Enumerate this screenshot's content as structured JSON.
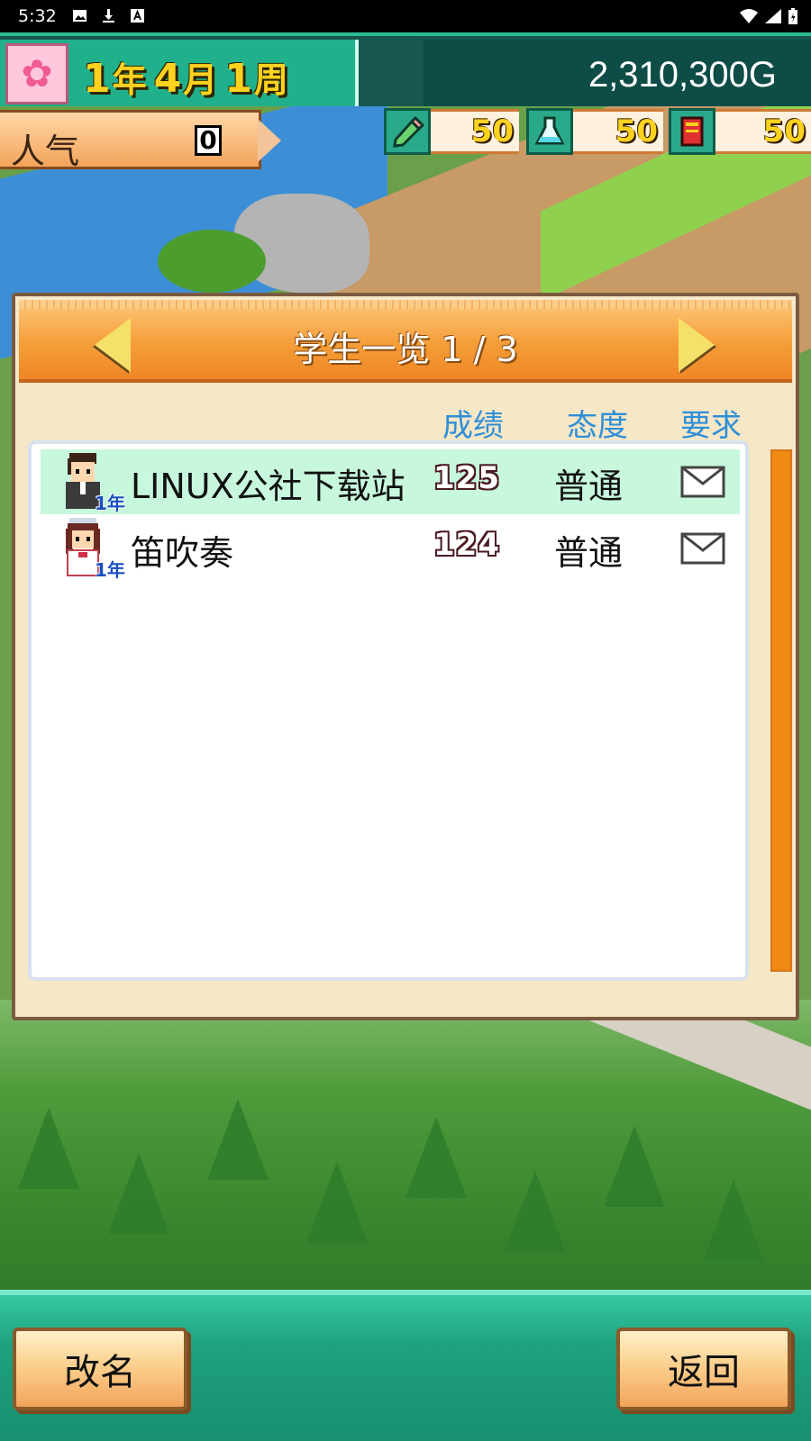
{
  "status_bar": {
    "time": "5:32"
  },
  "hud": {
    "date": {
      "year": "1",
      "year_unit": "年",
      "month": "4",
      "month_unit": "月",
      "week": "1",
      "week_unit": "周"
    },
    "money": "2,310,300G",
    "popularity": {
      "label": "人气",
      "value": "0"
    },
    "resources": [
      {
        "icon": "pencil-icon",
        "value": "50"
      },
      {
        "icon": "flask-icon",
        "value": "50"
      },
      {
        "icon": "book-icon",
        "value": "50"
      }
    ]
  },
  "dialog": {
    "title": "学生一览 1 / 3",
    "columns": {
      "score": "成绩",
      "attitude": "态度",
      "request": "要求"
    },
    "students": [
      {
        "name": "LINUX公社下载站",
        "grade": "1年",
        "score": "125",
        "attitude": "普通",
        "request_icon": "envelope-icon",
        "selected": true
      },
      {
        "name": "笛吹奏",
        "grade": "1年",
        "score": "124",
        "attitude": "普通",
        "request_icon": "envelope-icon",
        "selected": false
      }
    ]
  },
  "buttons": {
    "rename": "改名",
    "back": "返回"
  },
  "colors": {
    "hud_teal": "#21b08c",
    "header_orange": "#f49e38",
    "column_blue": "#2f8fd8",
    "selected_row": "#c7f7dc",
    "scrollbar": "#f08a12"
  }
}
